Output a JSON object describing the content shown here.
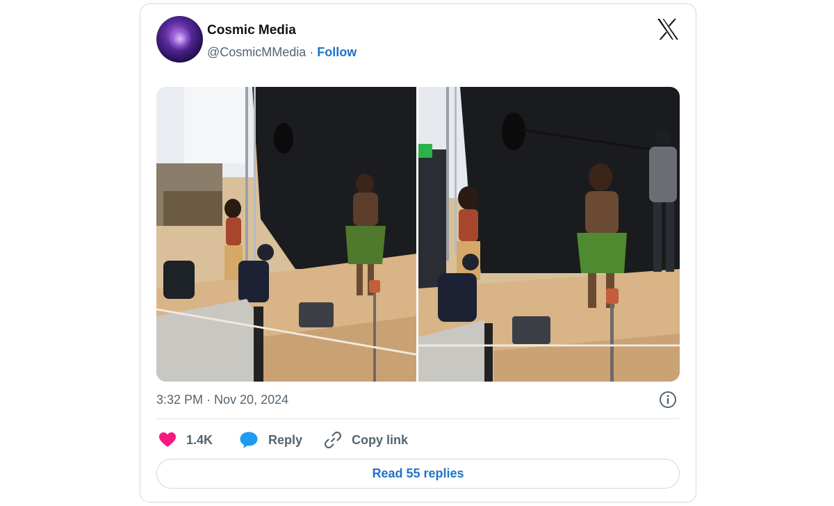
{
  "author": {
    "name": "Cosmic Media",
    "handle": "@CosmicMMedia",
    "separator": " · ",
    "follow_label": "Follow"
  },
  "icons": {
    "brand": "x-logo-icon",
    "info": "info-icon",
    "like": "heart-icon",
    "reply": "speech-bubble-icon",
    "copy": "link-icon"
  },
  "media": {
    "image_count": 2
  },
  "tweet": {
    "timestamp": "3:32 PM · Nov 20, 2024"
  },
  "actions": {
    "like_count": "1.4K",
    "reply_label": "Reply",
    "copy_label": "Copy link"
  },
  "footer": {
    "read_replies_label": "Read 55 replies"
  },
  "colors": {
    "like": "#f91880",
    "reply": "#1d9bf0",
    "link": "#1d73c7",
    "muted": "#536471"
  }
}
